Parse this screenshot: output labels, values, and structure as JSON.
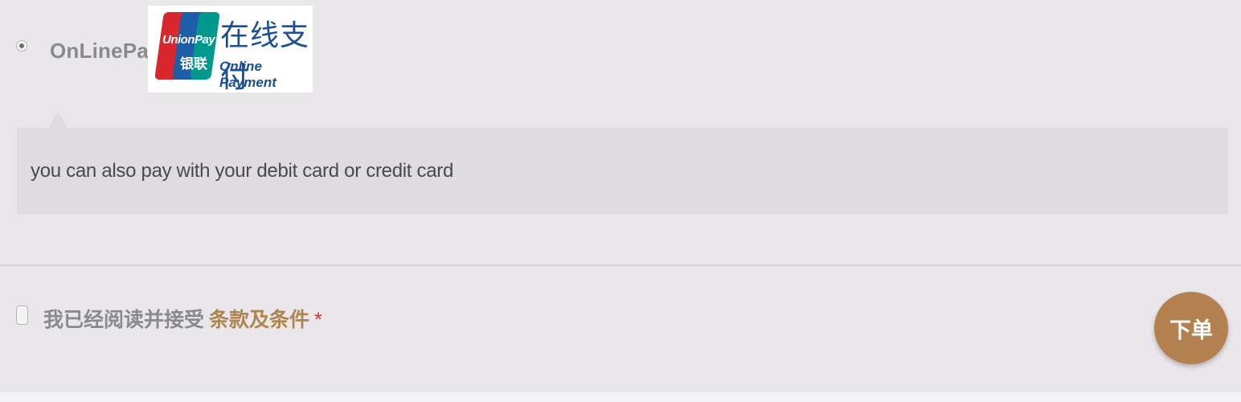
{
  "payment": {
    "method_label": "OnLinePay",
    "logo": {
      "brand_en": "UnionPay",
      "brand_cn": "银联",
      "title_cn": "在线支付",
      "title_en": "Online Payment",
      "colors": [
        "#d9272e",
        "#1e5ea8",
        "#009a8c"
      ]
    },
    "description": "you can also pay with your debit card or credit card"
  },
  "terms": {
    "text": "我已经阅读并接受",
    "link_label": "条款及条件",
    "required_mark": "*"
  },
  "order_button": {
    "label": "下单",
    "color": "#b3814f"
  },
  "colors": {
    "background": "#e9e7ea",
    "accent": "#b0844f",
    "required": "#d9302f"
  }
}
